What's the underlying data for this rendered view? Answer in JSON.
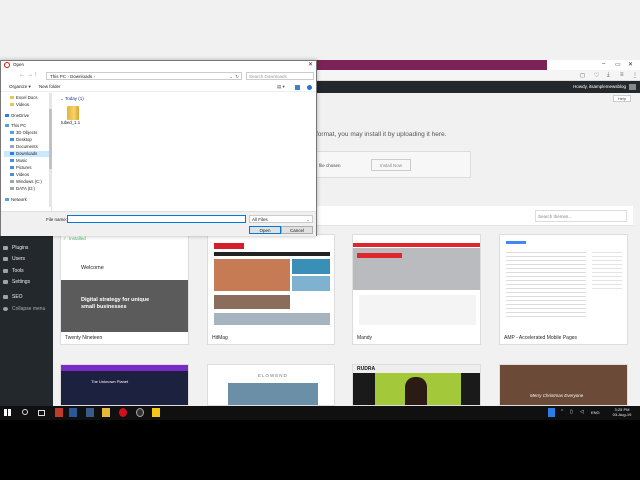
{
  "browser": {
    "account_greeting": "Howdy, itsamplemewsblog"
  },
  "wordpress": {
    "help_label": "Help",
    "upload_message": "format, you may install it by uploading it here.",
    "file_status": "file chosen",
    "install_button": "Install Now",
    "search_placeholder": "Search themes...",
    "sidebar": [
      {
        "label": "Plugins",
        "icon": "plug-icon"
      },
      {
        "label": "Users",
        "icon": "users-icon"
      },
      {
        "label": "Tools",
        "icon": "wrench-icon"
      },
      {
        "label": "Settings",
        "icon": "settings-icon"
      },
      {
        "label": "SEO",
        "icon": "seo-icon"
      },
      {
        "label": "Collapse menu",
        "icon": "collapse-icon"
      }
    ],
    "themes": [
      {
        "name": "Twenty Nineteen",
        "badge": "Installed",
        "headline": "Welcome",
        "tagline": "Digital strategy for unique small businesses"
      },
      {
        "name": "HitMag"
      },
      {
        "name": "Mandy"
      },
      {
        "name": "AMP - Accelerated Mobile Pages"
      }
    ],
    "second_row": {
      "card1_title": "The Unknown Planet",
      "card2_title": "ELOWEND",
      "card3_title": "RUDRA",
      "card4_title": "Merry Christmas Everyone"
    }
  },
  "dialog": {
    "title": "Open",
    "path_root": "This PC",
    "path_folder": "Downloads",
    "search_placeholder": "Search Downloads",
    "organize": "Organize",
    "new_folder": "New folder",
    "group_label": "Today (1)",
    "file_name": "tubed_1.1",
    "file_name_label": "File name:",
    "file_name_value": "",
    "filter_value": "All Files",
    "open_label": "Open",
    "cancel_label": "Cancel",
    "nav_items": [
      "Excel Docs",
      "Videos",
      "OneDrive",
      "This PC",
      "3D Objects",
      "Desktop",
      "Documents",
      "Downloads",
      "Music",
      "Pictures",
      "Videos",
      "Windows (C:)",
      "DATA (D:)",
      "Network"
    ]
  },
  "taskbar": {
    "language": "ENG",
    "time": "3:25 PM",
    "date": "03-Aug-19"
  },
  "colors": {
    "wp_dark": "#23282d",
    "browser_accent": "#7b2257",
    "installed_green": "#4ab866",
    "hitmag_red": "#d61f2b",
    "mandy_red": "#e0262c",
    "tagline_bg": "#5b5b5b"
  }
}
